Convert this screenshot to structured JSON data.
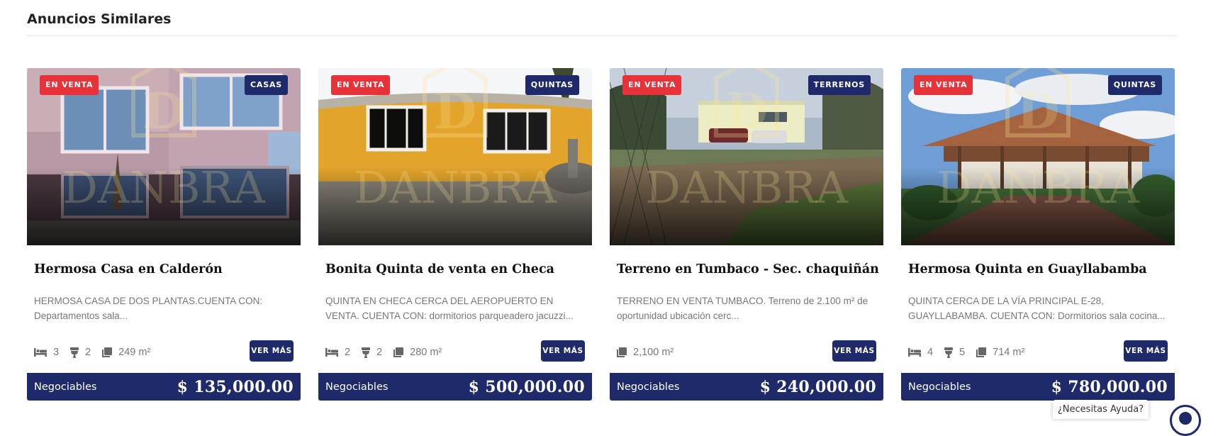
{
  "section": {
    "title": "Anuncios Similares"
  },
  "colors": {
    "sale_badge": "#e8323a",
    "navy": "#1f2a6b",
    "muted_text": "#777777"
  },
  "watermark_text": "DANBRA",
  "listings": [
    {
      "status_badge": "EN VENTA",
      "type_badge": "CASAS",
      "title": "Hermosa Casa en Calderón",
      "description": "HERMOSA CASA DE DOS PLANTAS.CUENTA CON: Departamentos sala...",
      "features": [
        {
          "icon": "bed-icon",
          "value": "3"
        },
        {
          "icon": "toilet-icon",
          "value": "2"
        },
        {
          "icon": "area-icon",
          "value": "249 m²"
        }
      ],
      "button_label": "VER MÁS",
      "price_note": "Negociables",
      "price": "$ 135,000.00"
    },
    {
      "status_badge": "EN VENTA",
      "type_badge": "QUINTAS",
      "title": "Bonita Quinta de venta en Checa",
      "description": "QUINTA EN CHECA CERCA DEL AEROPUERTO EN VENTA. CUENTA CON: dormitorios parqueadero jacuzzi...",
      "features": [
        {
          "icon": "bed-icon",
          "value": "2"
        },
        {
          "icon": "toilet-icon",
          "value": "2"
        },
        {
          "icon": "area-icon",
          "value": "280 m²"
        }
      ],
      "button_label": "VER MÁS",
      "price_note": "Negociables",
      "price": "$ 500,000.00"
    },
    {
      "status_badge": "EN VENTA",
      "type_badge": "TERRENOS",
      "title": "Terreno en Tumbaco - Sec. chaquiñán",
      "description": "TERRENO EN VENTA TUMBACO. Terreno de 2.100 m² de oportunidad ubicación cerc...",
      "features": [
        {
          "icon": "area-icon",
          "value": "2,100 m²"
        }
      ],
      "button_label": "VER MÁS",
      "price_note": "Negociables",
      "price": "$ 240,000.00"
    },
    {
      "status_badge": "EN VENTA",
      "type_badge": "QUINTAS",
      "title": "Hermosa Quinta en Guayllabamba",
      "description": "QUINTA CERCA DE LA VÍA PRINCIPAL E-28, GUAYLLABAMBA. CUENTA CON: Dormitorios sala cocina...",
      "features": [
        {
          "icon": "bed-icon",
          "value": "4"
        },
        {
          "icon": "toilet-icon",
          "value": "5"
        },
        {
          "icon": "area-icon",
          "value": "714 m²"
        }
      ],
      "button_label": "VER MÁS",
      "price_note": "Negociables",
      "price": "$ 780,000.00"
    }
  ],
  "help_widget": {
    "label": "¿Necesitas Ayuda?"
  }
}
